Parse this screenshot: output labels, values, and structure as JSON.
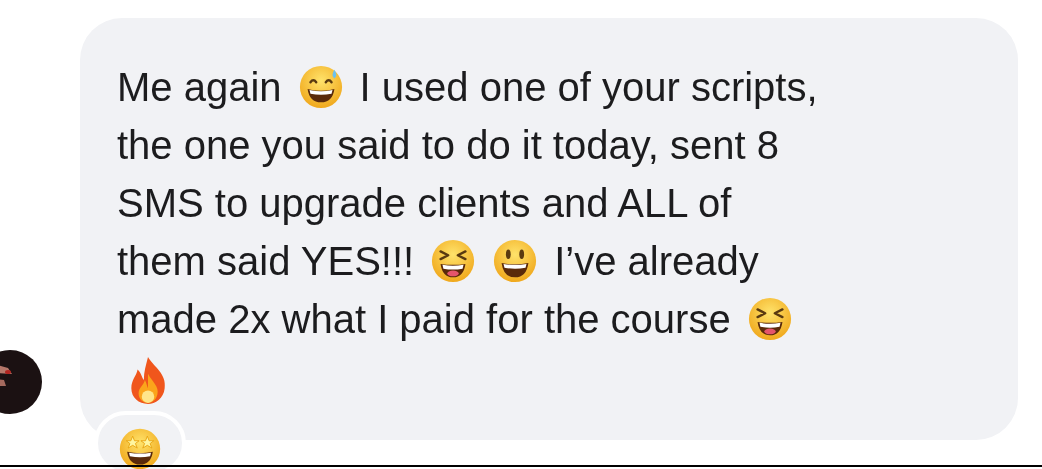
{
  "message": {
    "lines": [
      [
        {
          "kind": "text",
          "text": "Me again"
        },
        {
          "kind": "grin-sweat"
        },
        {
          "kind": "text",
          "text": "I used one of your scripts,"
        }
      ],
      [
        {
          "kind": "text",
          "text": "the one you said to do it today, sent 8"
        }
      ],
      [
        {
          "kind": "text",
          "text": "SMS to upgrade clients and ALL of"
        }
      ],
      [
        {
          "kind": "text",
          "text": "them said YES!!!"
        },
        {
          "kind": "squint-laugh"
        },
        {
          "kind": "smile"
        },
        {
          "kind": "text",
          "text": "I’ve already"
        }
      ],
      [
        {
          "kind": "text",
          "text": "made 2x what I paid for the course"
        },
        {
          "kind": "squint-laugh"
        }
      ],
      [
        {
          "kind": "fire"
        }
      ]
    ],
    "reaction": {
      "kind": "star-eyes"
    }
  }
}
